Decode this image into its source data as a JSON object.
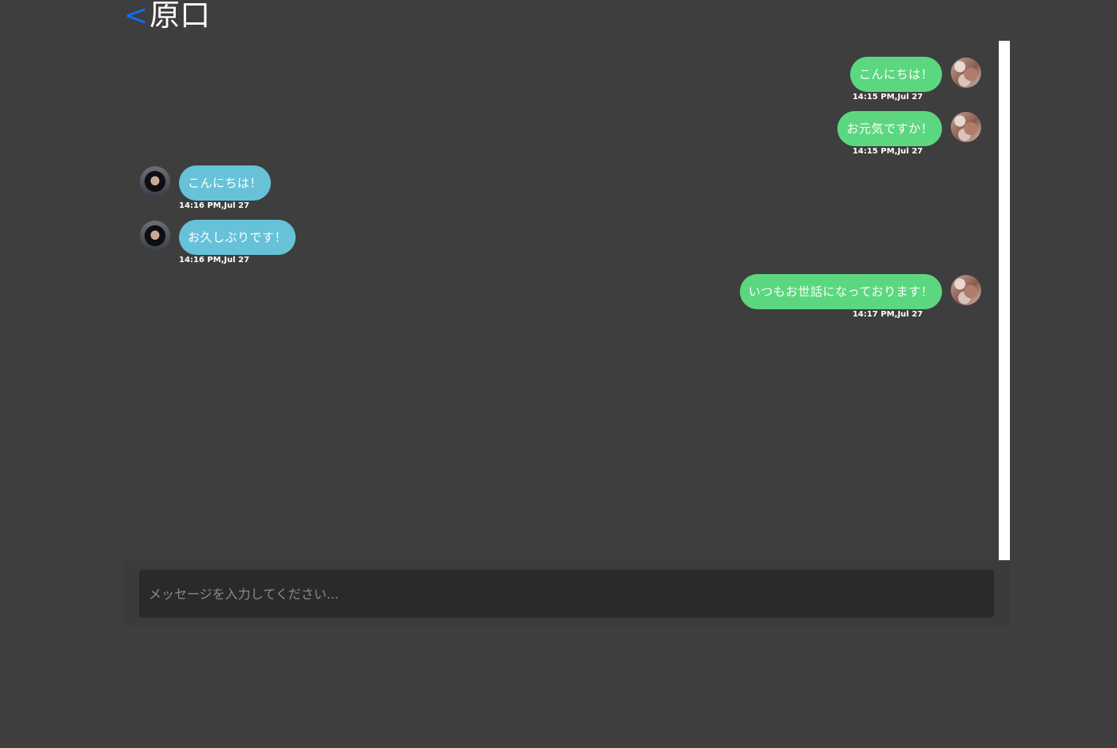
{
  "header": {
    "back_label": "<",
    "title": "原口"
  },
  "messages": [
    {
      "direction": "sent",
      "text": "こんにちは！",
      "time": "14:15 PM,Jul 27"
    },
    {
      "direction": "sent",
      "text": "お元気ですか！",
      "time": "14:15 PM,Jul 27"
    },
    {
      "direction": "received",
      "text": "こんにちは！",
      "time": "14:16 PM,Jul 27"
    },
    {
      "direction": "received",
      "text": "お久しぶりです！",
      "time": "14:16 PM,Jul 27"
    },
    {
      "direction": "sent",
      "text": "いつもお世話になっております！",
      "time": "14:17 PM,Jul 27"
    }
  ],
  "composer": {
    "value": "",
    "placeholder": "メッセージを入力してください..."
  },
  "colors": {
    "background": "#3e3e3e",
    "sent_bubble": "#5bd87f",
    "received_bubble": "#67c2d8",
    "back_link": "#0d6efd",
    "input_background": "#2a2a2a"
  }
}
